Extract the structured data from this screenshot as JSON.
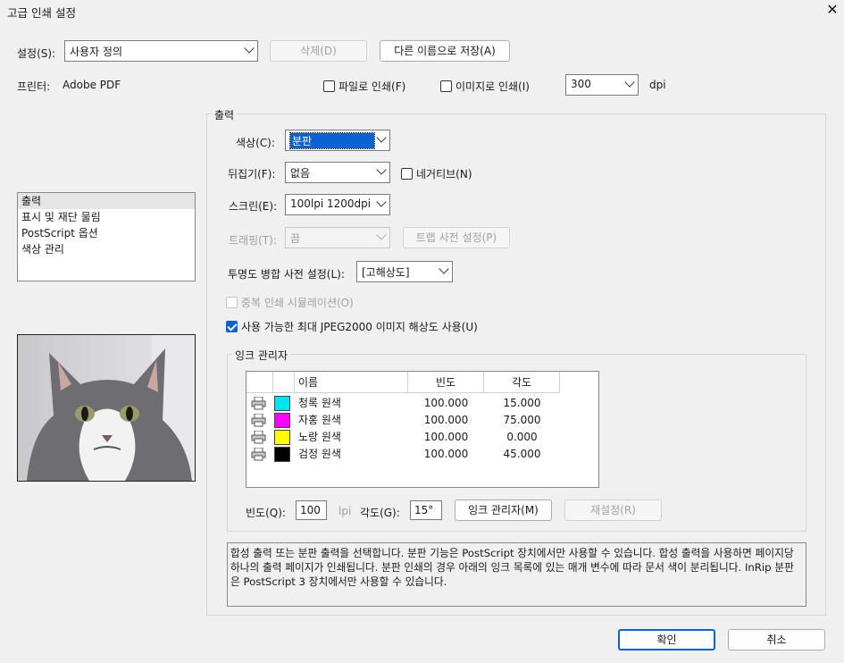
{
  "window": {
    "title": "고급 인쇄 설정",
    "close": "✕"
  },
  "settings": {
    "label": "설정(S):",
    "value": "사용자 정의",
    "delete_label": "삭제(D)",
    "save_as_label": "다른 이름으로 저장(A)"
  },
  "printer": {
    "label": "프린터:",
    "value": "Adobe PDF",
    "print_to_file": "파일로 인쇄(F)",
    "print_as_image": "이미지로 인쇄(I)",
    "dpi_value": "300",
    "dpi_unit": "dpi"
  },
  "sidebar": {
    "items": [
      {
        "label": "출력"
      },
      {
        "label": "표시 및 재단 물림"
      },
      {
        "label": "PostScript 옵션"
      },
      {
        "label": "색상 관리"
      }
    ]
  },
  "output": {
    "group_title": "출력",
    "color_label": "색상(C):",
    "color_value": "분판",
    "flip_label": "뒤집기(F):",
    "flip_value": "없음",
    "negative_label": "네거티브(N)",
    "screen_label": "스크린(E):",
    "screen_value": "100lpi 1200dpi",
    "trapping_label": "트래핑(T):",
    "trapping_value": "끔",
    "trap_presets_label": "트랩 사전 설정(P)",
    "transparency_label": "투명도 병합 사전 설정(L):",
    "transparency_value": "[고해상도]",
    "overprint_label": "중복 인쇄 시뮬레이션(O)",
    "jpeg2000_label": "사용 가능한 최대 JPEG2000 이미지 해상도 사용(U)"
  },
  "ink_manager": {
    "group_title": "잉크 관리자",
    "headers": {
      "name": "이름",
      "frequency": "빈도",
      "angle": "각도"
    },
    "inks": [
      {
        "name": "청록 원색",
        "frequency": "100.000",
        "angle": "15.000",
        "color": "#00e5ef"
      },
      {
        "name": "자홍 원색",
        "frequency": "100.000",
        "angle": "75.000",
        "color": "#ff00ff"
      },
      {
        "name": "노랑 원색",
        "frequency": "100.000",
        "angle": "0.000",
        "color": "#ffff00"
      },
      {
        "name": "검정 원색",
        "frequency": "100.000",
        "angle": "45.000",
        "color": "#000000"
      }
    ],
    "freq_label": "빈도(Q):",
    "freq_value": "100",
    "freq_unit": "lpi",
    "angle_label": "각도(G):",
    "angle_value": "15°",
    "ink_manager_button": "잉크 관리자(M)",
    "reset_button": "재설정(R)"
  },
  "help_text": "합성 출력 또는 분판 출력을 선택합니다. 분판 기능은 PostScript 장치에서만 사용할 수 있습니다. 합성 출력을 사용하면 페이지당 하나의 출력 페이지가 인쇄됩니다. 분판 인쇄의 경우 아래의 잉크 목록에 있는 매개 변수에 따라 문서 색이 분리됩니다. InRip 분판은 PostScript 3 장치에서만 사용할 수 있습니다.",
  "footer": {
    "ok_label": "확인",
    "cancel_label": "취소"
  }
}
